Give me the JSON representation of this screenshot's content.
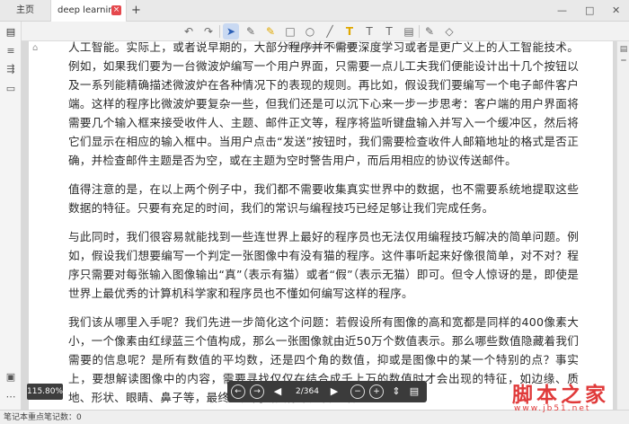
{
  "tabs": {
    "home": "主页",
    "doc": "deep learning",
    "close": "×",
    "add": "+"
  },
  "window": {
    "minimize": "—",
    "maximize": "□",
    "close": "✕"
  },
  "toolbar": {
    "undo_icon": "↶",
    "redo_icon": "↷",
    "select_icon": "➤",
    "pen_icon": "✎",
    "highlighter_icon": "✎",
    "rect_icon": "□",
    "circle_icon": "○",
    "line_icon": "╱",
    "text_highlight_icon": "T",
    "text_icon": "T",
    "text_box_icon": "T",
    "note_icon": "▤",
    "marker_icon": "✎",
    "eraser_icon": "◇"
  },
  "sidebar": {
    "icon_1": "▤",
    "icon_2": "≡",
    "icon_3": "⇶",
    "icon_4": "▭",
    "icon_5": "▣",
    "icon_6": "⋯"
  },
  "document": {
    "title": "deep learning.pdf",
    "bookmark": "⌂",
    "paragraphs": [
      "人工智能。实际上，或者说早期的，大部分程序并不需要深度学习或者是更广义上的人工智能技术。例如，如果我们要为一台微波炉编写一个用户界面，只需要一点儿工夫我们便能设计出十几个按钮以及一系列能精确描述微波炉在各种情况下的表现的规则。再比如，假设我们要编写一个电子邮件客户端。这样的程序比微波炉要复杂一些，但我们还是可以沉下心来一步一步思考：客户端的用户界面将需要几个输入框来接受收件人、主题、邮件正文等，程序将监听键盘输入并写入一个缓冲区，然后将它们显示在相应的输入框中。当用户点击“发送”按钮时，我们需要检查收件人邮箱地址的格式是否正确，并检查邮件主题是否为空，或在主题为空时警告用户，而后用相应的协议传送邮件。",
      "值得注意的是，在以上两个例子中，我们都不需要收集真实世界中的数据，也不需要系统地提取这些数据的特征。只要有充足的时间，我们的常识与编程技巧已经足够让我们完成任务。",
      "与此同时，我们很容易就能找到一些连世界上最好的程序员也无法仅用编程技巧解决的简单问题。例如，假设我们想要编写一个判定一张图像中有没有猫的程序。这件事听起来好像很简单，对不对？程序只需要对每张输入图像输出“真”（表示有猫）或者“假”（表示无猫）即可。但令人惊讶的是，即使是世界上最优秀的计算机科学家和程序员也不懂如何编写这样的程序。",
      "我们该从哪里入手呢？我们先进一步简化这个问题：若假设所有图像的高和宽都是同样的400像素大小，一个像素由红绿蓝三个值构成，那么一张图像就由近50万个数值表示。那么哪些数值隐藏着我们需要的信息呢？是所有数值的平均数，还是四个角的数值，抑或是图像中的某一个特别的点？事实上，要想解读图像中的内容，需要寻找仅仅在结合成千上万的数值时才会出现的特征，如边缘、质地、形状、眼睛、鼻子等，最终才能判断图像中是否有猫。"
    ]
  },
  "scrollbar": {
    "top_icon": "▤"
  },
  "zoom": {
    "level": "115.80%"
  },
  "navbar": {
    "back_icon": "←",
    "forward_icon": "→",
    "prev_icon": "◀",
    "page": "2/364",
    "next_icon": "▶",
    "zoom_out_icon": "−",
    "zoom_in_icon": "+",
    "fit_icon": "⇕",
    "layout_icon": "▤"
  },
  "status": {
    "text": "笔记本重点笔记数：0"
  },
  "watermark": {
    "main": "脚本之家",
    "sub": "www.jb51.net"
  }
}
